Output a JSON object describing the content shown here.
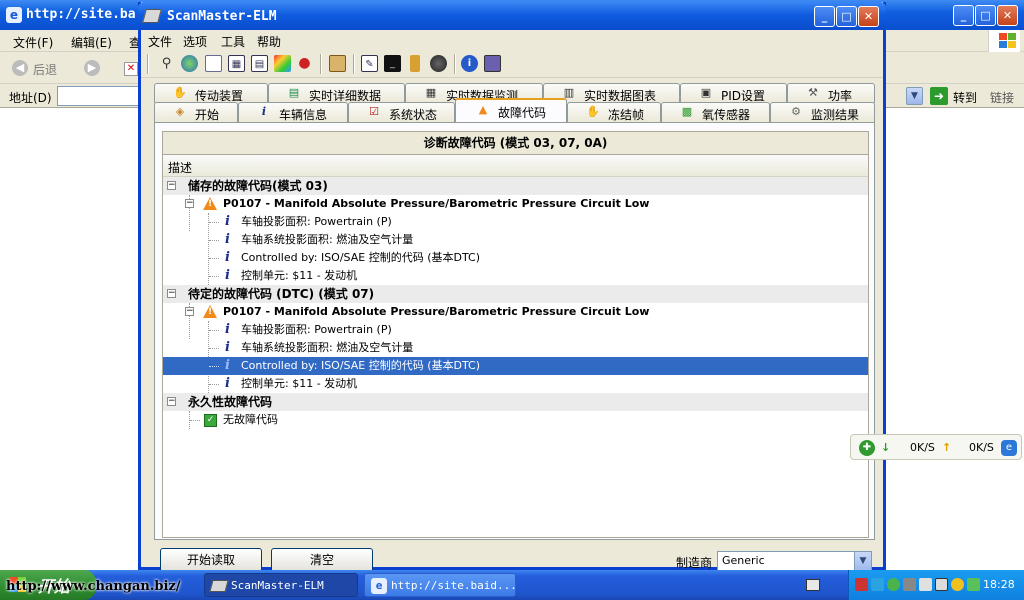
{
  "browser": {
    "title": "http://site.bai",
    "menus": [
      "文件(F)",
      "编辑(E)",
      "查"
    ],
    "back_label": "后退",
    "address_label": "地址(D)",
    "go_label": "转到",
    "links_label": "链接"
  },
  "app": {
    "title": "ScanMaster-ELM",
    "menus": [
      "文件",
      "选项",
      "工具",
      "帮助"
    ],
    "tabs_row1": [
      {
        "label": "传动装置",
        "icon": "hand-icon"
      },
      {
        "label": "实时详细数据",
        "icon": "list-icon"
      },
      {
        "label": "实时数据监测",
        "icon": "monitor-grid-icon"
      },
      {
        "label": "实时数据图表",
        "icon": "chart-icon"
      },
      {
        "label": "PID设置",
        "icon": "document-icon"
      },
      {
        "label": "功率",
        "icon": "wrench-icon"
      }
    ],
    "tabs_row2": [
      {
        "label": "开始",
        "icon": "cube-icon"
      },
      {
        "label": "车辆信息",
        "icon": "info-icon"
      },
      {
        "label": "系统状态",
        "icon": "checkbox-icon"
      },
      {
        "label": "故障代码",
        "icon": "warning-icon"
      },
      {
        "label": "冻结帧",
        "icon": "hand-icon"
      },
      {
        "label": "氧传感器",
        "icon": "sensor-icon"
      },
      {
        "label": "监测结果",
        "icon": "gear-icon"
      }
    ],
    "active_tab": "故障代码",
    "panel_title": "诊断故障代码 (模式 03, 07, 0A)",
    "column_header": "描述",
    "groups": [
      {
        "title": "储存的故障代码(模式 03)",
        "code": "P0107 - Manifold Absolute Pressure/Barometric Pressure Circuit Low",
        "details": [
          "车轴投影面积: Powertrain (P)",
          "车轴系统投影面积: 燃油及空气计量",
          "Controlled by: ISO/SAE 控制的代码 (基本DTC)",
          "控制单元: $11 - 发动机"
        ]
      },
      {
        "title": "待定的故障代码 (DTC) (模式 07)",
        "code": "P0107 - Manifold Absolute Pressure/Barometric Pressure Circuit Low",
        "details": [
          "车轴投影面积: Powertrain (P)",
          "车轴系统投影面积: 燃油及空气计量",
          "Controlled by: ISO/SAE 控制的代码 (基本DTC)",
          "控制单元: $11 - 发动机"
        ]
      },
      {
        "title": "永久性故障代码",
        "no_code": "无故障代码"
      }
    ],
    "selected_row": "Controlled by: ISO/SAE 控制的代码 (基本DTC)",
    "buttons": {
      "start_read": "开始读取",
      "clear": "清空"
    },
    "maker_label": "制造商",
    "maker_value": "Generic"
  },
  "network": {
    "download": "0K/S",
    "upload": "0K/S"
  },
  "taskbar": {
    "start": "开始",
    "watermark": "http://www.changan.biz/",
    "tasks": [
      {
        "label": "ScanMaster-ELM",
        "active": true
      },
      {
        "label": "http://site.baid...",
        "active": false
      }
    ],
    "time": "18:28"
  }
}
